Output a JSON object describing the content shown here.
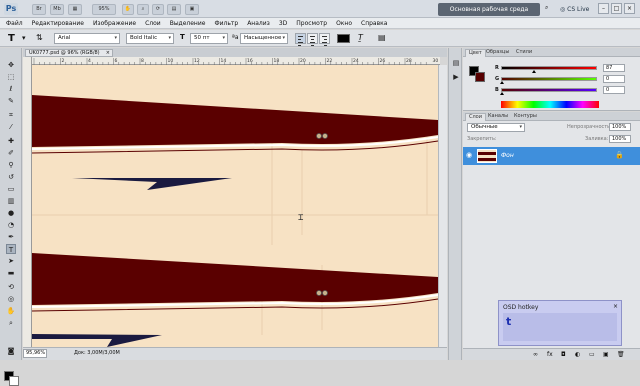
{
  "app": {
    "logo": "Ps",
    "workspace": "Основная рабочая среда",
    "cs_live": "CS Live",
    "zoom_select": "95%"
  },
  "menu": [
    "Файл",
    "Редактирование",
    "Изображение",
    "Слои",
    "Выделение",
    "Фильтр",
    "Анализ",
    "3D",
    "Просмотр",
    "Окно",
    "Справка"
  ],
  "options": {
    "font_family": "Arial",
    "font_style": "Bold Italic",
    "font_size": "50 пт",
    "antialias": "Насыщенное",
    "text_color": "#000000"
  },
  "document": {
    "tab_title": "UK0777.psd @ 96% (RGB/8)",
    "ruler_ticks": [
      "2",
      "4",
      "6",
      "8",
      "10",
      "12",
      "14",
      "16",
      "18",
      "20",
      "22",
      "24",
      "26",
      "28",
      "30"
    ]
  },
  "status": {
    "zoom": "95,96%",
    "doc_size": "Док: 3,00M/3,00M"
  },
  "color_panel": {
    "tabs": [
      "Цвет",
      "Образцы",
      "Стили"
    ],
    "channels": [
      {
        "label": "R",
        "value": "87",
        "level": 0.34,
        "gradient": "linear-gradient(90deg,#000000,#ff0000)"
      },
      {
        "label": "G",
        "value": "0",
        "level": 0.0,
        "gradient": "linear-gradient(90deg,#570000,#57ff00)"
      },
      {
        "label": "B",
        "value": "0",
        "level": 0.0,
        "gradient": "linear-gradient(90deg,#570000,#5700ff)"
      }
    ],
    "foreground": "#570000",
    "background": "#000000"
  },
  "layers_panel": {
    "tabs": [
      "Слои",
      "Каналы",
      "Контуры"
    ],
    "blend_mode": "Обычные",
    "opacity_label": "Непрозрачность:",
    "opacity": "100%",
    "lock_label": "Закрепить:",
    "fill_label": "Заливка:",
    "fill": "100%",
    "layer_name": "Фон"
  },
  "osd": {
    "title": "OSD hotkey",
    "key": "t"
  },
  "colors": {
    "stripe": "#5a0000",
    "canvas": "#f7e2c4",
    "arrow": "#1a1a40",
    "selection": "#3f8fdc"
  }
}
